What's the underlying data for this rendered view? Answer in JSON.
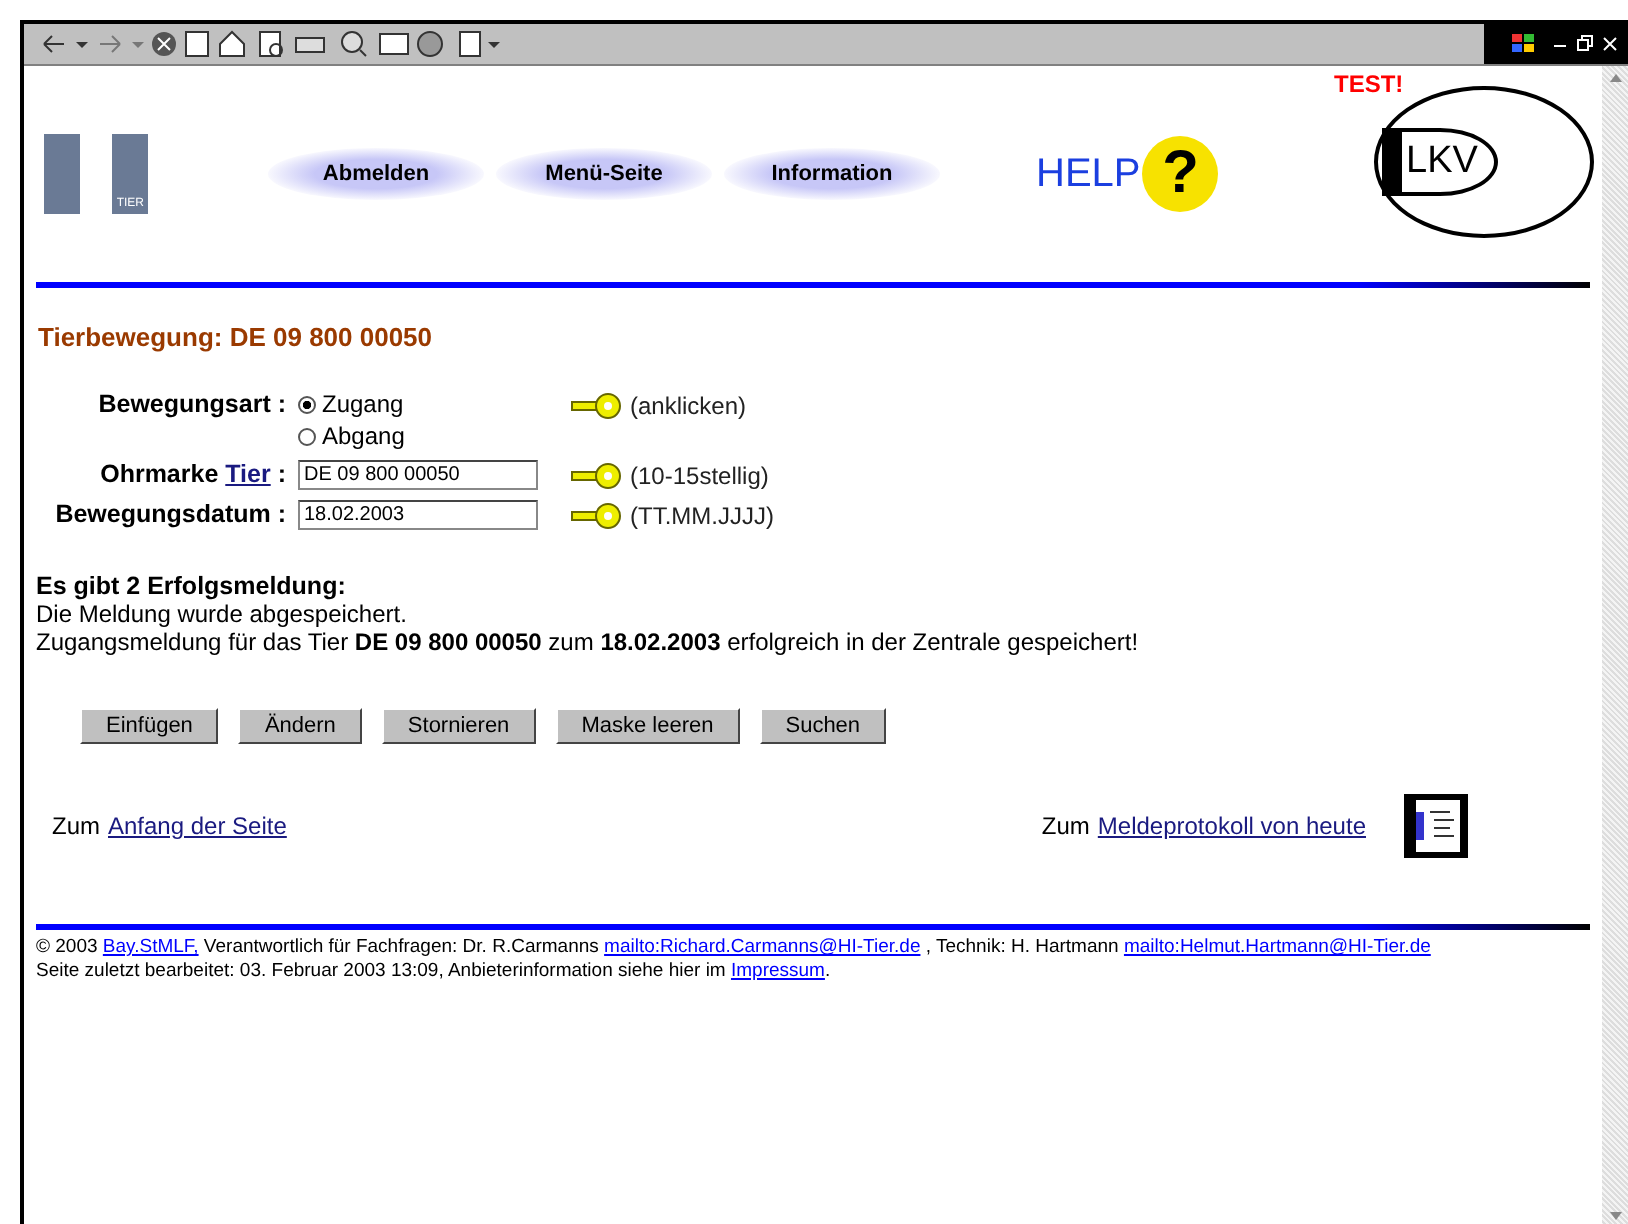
{
  "header": {
    "logo_text": "TIER",
    "nav": [
      {
        "label": "Abmelden"
      },
      {
        "label": "Menü-Seite"
      },
      {
        "label": "Information"
      }
    ],
    "test_label": "TEST!",
    "help_logo": {
      "text": "HELP",
      "mark": "?"
    },
    "lkv_logo": "LKV"
  },
  "title": "Tierbewegung: DE 09 800 00050",
  "form": {
    "movement": {
      "label": "Bewegungsart :",
      "options": [
        {
          "label": "Zugang",
          "selected": true
        },
        {
          "label": "Abgang",
          "selected": false
        }
      ],
      "hint": "(anklicken)"
    },
    "eartag": {
      "label": "Ohrmarke",
      "link": "Tier",
      "colon": ":",
      "value": "DE 09 800 00050",
      "hint": "(10-15stellig)"
    },
    "date": {
      "label": "Bewegungsdatum :",
      "value": "18.02.2003",
      "hint": "(TT.MM.JJJJ)"
    }
  },
  "messages": {
    "heading": "Es gibt 2 Erfolgsmeldung:",
    "lines": [
      "Die Meldung wurde abgespeichert.",
      "Zugangsmeldung für das Tier **DE 09 800 00050** zum **18.02.2003** erfolgreich in der Zentrale gespeichert!"
    ]
  },
  "buttons": [
    "Einfügen",
    "Ändern",
    "Stornieren",
    "Maske leeren",
    "Suchen"
  ],
  "links": [
    {
      "prefix": "Zum",
      "link": "Anfang der Seite"
    },
    {
      "prefix": "Zum",
      "link": "Meldeprotokoll von heute"
    }
  ],
  "footer": [
    [
      {
        "kind": "text",
        "text": "© 2003 "
      },
      {
        "kind": "link",
        "text": "Bay.StMLF,"
      },
      {
        "kind": "text",
        "text": " Verantwortlich für Fachfragen: Dr. R.Carmanns "
      },
      {
        "kind": "link",
        "text": "mailto:Richard.Carmanns@HI-Tier.de"
      },
      {
        "kind": "text",
        "text": " , Technik: H. Hartmann "
      },
      {
        "kind": "link",
        "text": "mailto:Helmut.Hartmann@HI-Tier.de"
      }
    ],
    [
      {
        "kind": "text",
        "text": "Seite zuletzt bearbeitet: 03. Februar 2003 13:09, Anbieterinformation siehe hier im "
      },
      {
        "kind": "link",
        "text": "Impressum"
      },
      {
        "kind": "text",
        "text": "."
      }
    ]
  ]
}
